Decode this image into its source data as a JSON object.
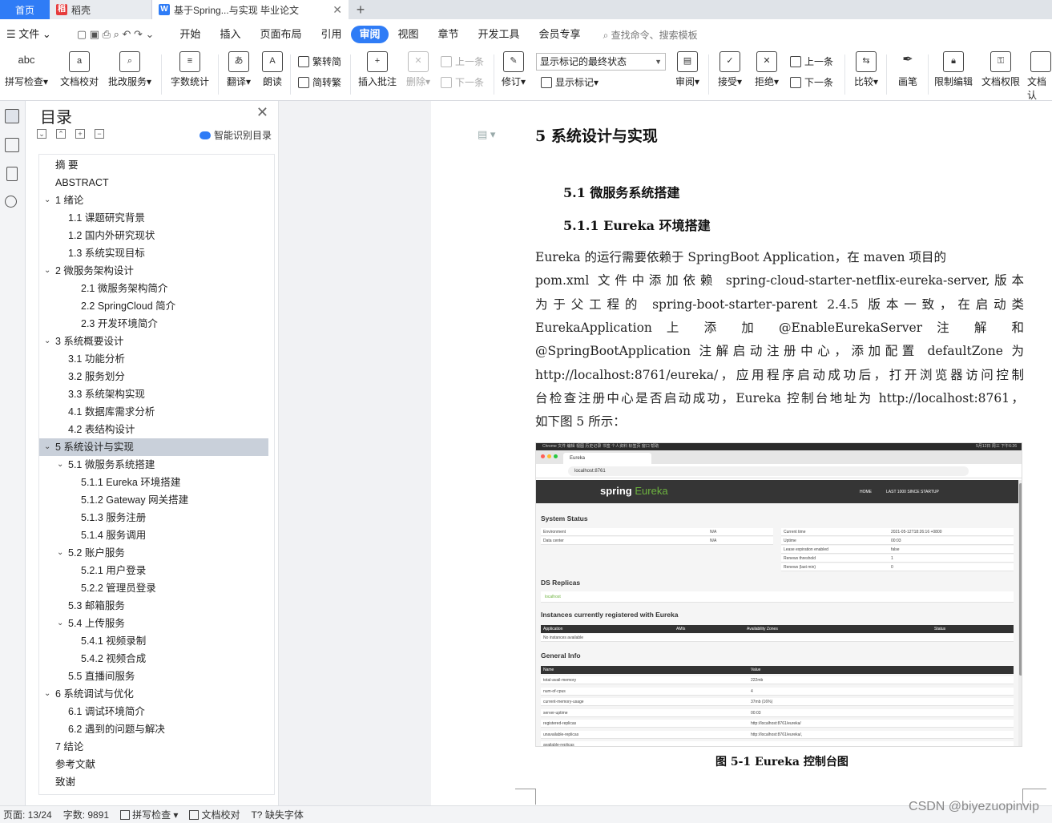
{
  "tabs": [
    {
      "label": "首页"
    },
    {
      "label": "稻壳"
    },
    {
      "label": "基于Spring...与实现 毕业论文"
    }
  ],
  "menus": [
    "文件",
    "开始",
    "插入",
    "页面布局",
    "引用",
    "审阅",
    "视图",
    "章节",
    "开发工具",
    "会员专享"
  ],
  "search_placeholder": "查找命令、搜索模板",
  "toolbar": {
    "spell_check": "拼写检查",
    "doc_proof": "文档校对",
    "batch_service": "批改服务",
    "word_count": "字数统计",
    "translate": "翻译",
    "read_aloud": "朗读",
    "trad_to_simp": "繁转简",
    "simp_to_trad": "简转繁",
    "insert_comment": "插入批注",
    "delete": "删除",
    "prev_comment": "上一条",
    "next_comment": "下一条",
    "revise": "修订",
    "markup_mode": "显示标记的最终状态",
    "show_markup": "显示标记",
    "review": "审阅",
    "accept": "接受",
    "reject": "拒绝",
    "prev_change": "上一条",
    "next_change": "下一条",
    "compare": "比较",
    "pen": "画笔",
    "restrict_edit": "限制编辑",
    "doc_permission": "文档权限",
    "doc_more": "文档认"
  },
  "toc": {
    "title": "目录",
    "smart": "智能识别目录",
    "items": [
      {
        "label": "摘  要",
        "level": 0
      },
      {
        "label": "ABSTRACT",
        "level": 0
      },
      {
        "label": "1  绪论",
        "level": 0,
        "expand": true
      },
      {
        "label": "1.1  课题研究背景",
        "level": 1
      },
      {
        "label": "1.2  国内外研究现状",
        "level": 1
      },
      {
        "label": "1.3  系统实现目标",
        "level": 1
      },
      {
        "label": "2  微服务架构设计",
        "level": 0,
        "expand": true
      },
      {
        "label": "2.1  微服务架构简介",
        "level": 2
      },
      {
        "label": "2.2 SpringCloud 简介",
        "level": 2
      },
      {
        "label": "2.3  开发环境简介",
        "level": 2
      },
      {
        "label": "3  系统概要设计",
        "level": 0,
        "expand": true
      },
      {
        "label": "3.1  功能分析",
        "level": 1
      },
      {
        "label": "3.2  服务划分",
        "level": 1
      },
      {
        "label": "3.3  系统架构实现",
        "level": 1
      },
      {
        "label": "4.1  数据库需求分析",
        "level": 1
      },
      {
        "label": "4.2  表结构设计",
        "level": 1
      },
      {
        "label": "5  系统设计与实现",
        "level": 0,
        "expand": true,
        "selected": true
      },
      {
        "label": "5.1  微服务系统搭建",
        "level": 1,
        "expand": true
      },
      {
        "label": "5.1.1 Eureka 环境搭建",
        "level": 2
      },
      {
        "label": "5.1.2 Gateway 网关搭建",
        "level": 2
      },
      {
        "label": "5.1.3  服务注册",
        "level": 2
      },
      {
        "label": "5.1.4  服务调用",
        "level": 2
      },
      {
        "label": "5.2  账户服务",
        "level": 1,
        "expand": true
      },
      {
        "label": "5.2.1  用户登录",
        "level": 2
      },
      {
        "label": "5.2.2  管理员登录",
        "level": 2
      },
      {
        "label": "5.3  邮箱服务",
        "level": 1
      },
      {
        "label": "5.4  上传服务",
        "level": 1,
        "expand": true
      },
      {
        "label": "5.4.1  视频录制",
        "level": 2
      },
      {
        "label": "5.4.2  视频合成",
        "level": 2
      },
      {
        "label": "5.5  直播间服务",
        "level": 1
      },
      {
        "label": "6  系统调试与优化",
        "level": 0,
        "expand": true
      },
      {
        "label": "6.1  调试环境简介",
        "level": 1
      },
      {
        "label": "6.2  遇到的问题与解决",
        "level": 1
      },
      {
        "label": "7  结论",
        "level": 0
      },
      {
        "label": "参考文献",
        "level": 0
      },
      {
        "label": "致谢",
        "level": 0
      }
    ]
  },
  "doc": {
    "h1": "5  系统设计与实现",
    "h2": "5.1  微服务系统搭建",
    "h3": "5.1.1  Eureka 环境搭建",
    "lines": [
      "    Eureka 的运行需要依赖于 SpringBoot Application，在 maven 项目的",
      "pom.xml 文件中添加依赖 spring-cloud-starter-netflix-eureka-server,版本",
      "为于父工程的 spring-boot-starter-parent 2.4.5 版本一致，在启动类",
      "EurekaApplication  上  添  加  @EnableEurekaServer  注  解  和",
      "@SpringBootApplication 注解启动注册中心，添加配置 defaultZone 为",
      "http://localhost:8761/eureka/，应用程序启动成功后，打开浏览器访问控制",
      "台检查注册中心是否启动成功，Eureka 控制台地址为 http://localhost:8761，",
      "如下图 5 所示："
    ],
    "caption": "图 5-1 Eureka 控制台图"
  },
  "figure": {
    "menubar": "Chrome   文件   编辑   视图   历史记录   书签   个人资料   标签页   窗口   帮助",
    "clock": "5月12日 周三 下午6:26",
    "tab": "Eureka",
    "url": "localhost:8761",
    "brand_spring": "spring",
    "brand_eureka": "Eureka",
    "nav_home": "HOME",
    "nav_last": "LAST 1000 SINCE STARTUP",
    "system_status": "System Status",
    "env_rows": [
      [
        "Environment",
        "N/A"
      ],
      [
        "Data center",
        "N/A"
      ]
    ],
    "time_rows": [
      [
        "Current time",
        "2021-05-12T18:26:16 +0800"
      ],
      [
        "Uptime",
        "00:03"
      ],
      [
        "Lease expiration enabled",
        "false"
      ],
      [
        "Renews threshold",
        "1"
      ],
      [
        "Renews (last min)",
        "0"
      ]
    ],
    "ds_replicas": "DS Replicas",
    "replica": "localhost",
    "instances": "Instances currently registered with Eureka",
    "inst_headers": [
      "Application",
      "AMIs",
      "Availability Zones",
      "Status"
    ],
    "no_instances": "No instances available",
    "general_info": "General Info",
    "gi_headers": [
      "Name",
      "Value"
    ],
    "gi_rows": [
      [
        "total-avail-memory",
        "222mb"
      ],
      [
        "num-of-cpus",
        "4"
      ],
      [
        "current-memory-usage",
        "37mb (16%)"
      ],
      [
        "server-uptime",
        "00:03"
      ],
      [
        "registered-replicas",
        "http://localhost:8761/eureka/"
      ],
      [
        "unavailable-replicas",
        "http://localhost:8761/eureka/,"
      ],
      [
        "available-replicas",
        ""
      ]
    ]
  },
  "status": {
    "page": "页面: 13/24",
    "words": "字数: 9891",
    "spell": "拼写检查",
    "proof": "文档校对",
    "missing_font": "缺失字体"
  },
  "watermark": "CSDN @biyezuopinvip"
}
